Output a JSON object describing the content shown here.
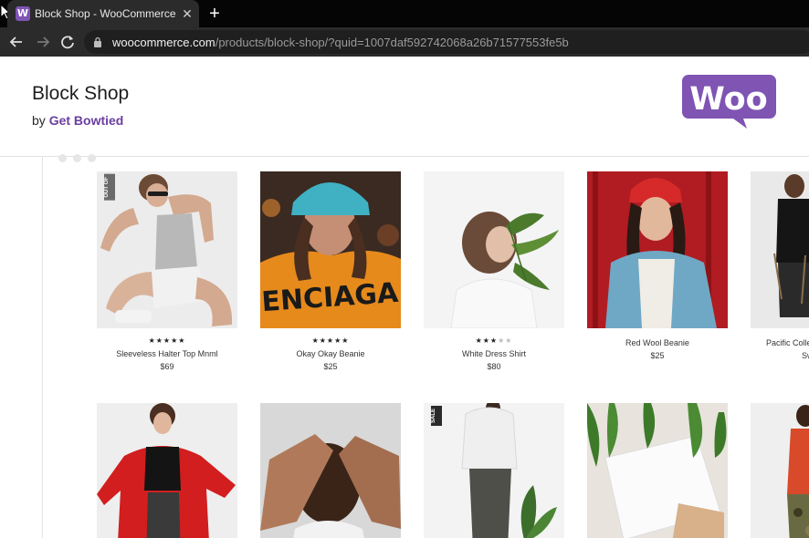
{
  "browser": {
    "tab_title": "Block Shop - WooCommerce",
    "tab_favicon_letter": "W",
    "url_host": "woocommerce.com",
    "url_path": "/products/block-shop/?quid=1007daf592742068a26b71577553fe5b"
  },
  "header": {
    "title": "Block Shop",
    "by": "by",
    "vendor": "Get Bowtied",
    "logo_text": "Woo",
    "logo_color": "#7f54b3"
  },
  "products": [
    {
      "name": "Sleeveless Halter Top Mnml",
      "price": "$69",
      "rating": 5,
      "badge": "OUT OF"
    },
    {
      "name": "Okay Okay Beanie",
      "price": "$25",
      "rating": 5,
      "image_text": "ENCIAGA"
    },
    {
      "name": "White Dress Shirt",
      "price": "$80",
      "rating": 3
    },
    {
      "name": "Red Wool Beanie",
      "price": "$25"
    },
    {
      "name": "Pacific Colles",
      "name2": "Sw"
    }
  ],
  "second_row": [
    {
      "image": "red-coat-woman"
    },
    {
      "image": "hands-face"
    },
    {
      "image": "white-puffer-jacket",
      "badge": "SALE"
    },
    {
      "image": "white-tshirt-plant"
    },
    {
      "image": "camo-pants"
    }
  ]
}
